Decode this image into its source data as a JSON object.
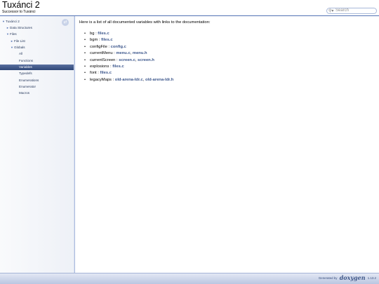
{
  "header": {
    "project_name": "Tuxánci 2",
    "project_brief": "Successor to Tuxánci",
    "search": {
      "placeholder": "Search",
      "value": ""
    }
  },
  "sidebar": {
    "items": [
      {
        "label": "Tuxánci 2",
        "arrow": "▼",
        "selected": false
      },
      {
        "label": "Data Structures",
        "arrow": "►",
        "selected": false
      },
      {
        "label": "Files",
        "arrow": "▼",
        "selected": false
      },
      {
        "label": "File List",
        "arrow": "►",
        "selected": false
      },
      {
        "label": "Globals",
        "arrow": "▼",
        "selected": false
      },
      {
        "label": "All",
        "arrow": "",
        "selected": false
      },
      {
        "label": "Functions",
        "arrow": "",
        "selected": false
      },
      {
        "label": "Variables",
        "arrow": "",
        "selected": true
      },
      {
        "label": "Typedefs",
        "arrow": "",
        "selected": false
      },
      {
        "label": "Enumerations",
        "arrow": "",
        "selected": false
      },
      {
        "label": "Enumerator",
        "arrow": "",
        "selected": false
      },
      {
        "label": "Macros",
        "arrow": "",
        "selected": false
      }
    ],
    "sync_icon": "sync-arrows-icon"
  },
  "content": {
    "intro": "Here is a list of all documented variables with links to the documentation:",
    "variables": [
      {
        "name": "bg",
        "files": [
          "files.c"
        ]
      },
      {
        "name": "bgm",
        "files": [
          "files.c"
        ]
      },
      {
        "name": "configFile",
        "files": [
          "config.c"
        ]
      },
      {
        "name": "currentMenu",
        "files": [
          "menu.c",
          "menu.h"
        ]
      },
      {
        "name": "currentScreen",
        "files": [
          "screen.c",
          "screen.h"
        ]
      },
      {
        "name": "explosions",
        "files": [
          "files.c"
        ]
      },
      {
        "name": "font",
        "files": [
          "files.c"
        ]
      },
      {
        "name": "legacyMaps",
        "files": [
          "old-arena-ldr.c",
          "old-arena-ldr.h"
        ]
      }
    ]
  },
  "footer": {
    "generated_by": "Generated by",
    "logo_text": "doxygen",
    "version": "1.13.2"
  },
  "colors": {
    "link": "#3d578c",
    "selected_bg": "#3c5589",
    "footer_bg": "#c5cfe6"
  }
}
